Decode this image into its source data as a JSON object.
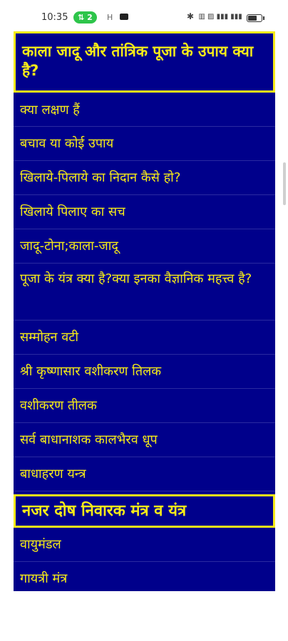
{
  "statusbar": {
    "time": "10:35",
    "pill": "2",
    "h_icon": "H",
    "right_icons": "bluetooth-icon signal-icon wifi-icon battery-icon"
  },
  "sections": [
    {
      "title": "काला जादू और तांत्रिक पूजा के उपाय क्या है?",
      "items": [
        "क्या लक्षण हैं",
        "बचाव या कोई उपाय",
        "खिलाये-पिलाये का निदान कैसे हो?",
        "खिलाये पिलाए का सच",
        "जादू-टोना;काला-जादू",
        "पूजा के यंत्र क्या है?क्या इनका वैज्ञानिक महत्त्व है?",
        "सम्मोहन वटी",
        "श्री कृष्णासार वशीकरण तिलक",
        "वशीकरण तीलक",
        "सर्व बाधानाशक कालभैरव धूप",
        "बाधाहरण यन्त्र"
      ]
    },
    {
      "title": "नजर दोष निवारक मंत्र व यंत्र",
      "items": [
        "वायुमंडल",
        "गायत्री मंत्र"
      ]
    }
  ],
  "colors": {
    "panel_bg": "#00008b",
    "text_yellow": "#f5ea19",
    "pill_green": "#2ec54a"
  }
}
